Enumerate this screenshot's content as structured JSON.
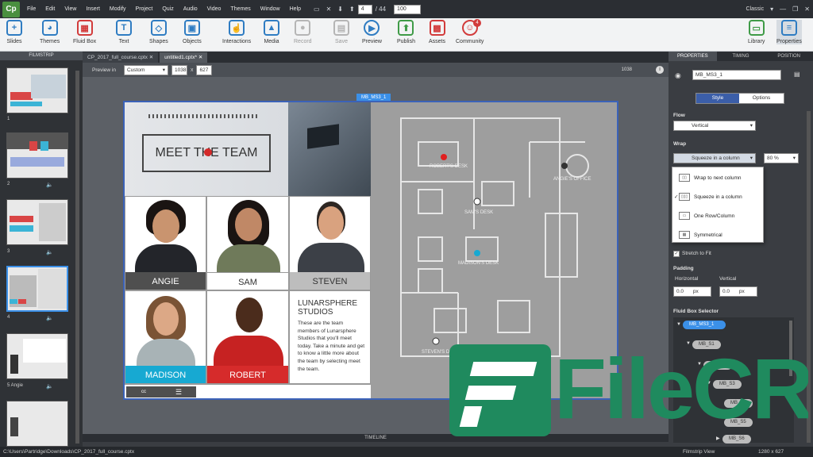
{
  "app": {
    "logo": "Cp",
    "workspace": "Classic"
  },
  "menu": [
    "File",
    "Edit",
    "View",
    "Insert",
    "Modify",
    "Project",
    "Quiz",
    "Audio",
    "Video",
    "Themes",
    "Window",
    "Help"
  ],
  "pager": {
    "current": "4",
    "total": "/ 44",
    "zoom": "100"
  },
  "toolbar": [
    "Slides",
    "Themes",
    "Fluid Box",
    "Text",
    "Shapes",
    "Objects",
    "Interactions",
    "Media",
    "Record",
    "Save",
    "Preview",
    "Publish",
    "Assets",
    "Community",
    "Library",
    "Properties"
  ],
  "community_badge": "4",
  "filmstrip": {
    "title": "FILMSTRIP",
    "slides": [
      "1",
      "2",
      "3",
      "4",
      "5 Angie",
      "6"
    ]
  },
  "tabs": [
    "CP_2017_full_course.cptx",
    "untitled1.cptx*"
  ],
  "preview": {
    "label": "Preview in",
    "mode": "Custom",
    "width": "1038",
    "x": "x",
    "height": "627",
    "ruler": "1038"
  },
  "slide": {
    "selection_label": "MB_MS3_1",
    "header": "MEET THE TEAM",
    "team": [
      {
        "name": "ANGIE",
        "color": "#4f4f4f"
      },
      {
        "name": "SAM",
        "color": "#ffffff"
      },
      {
        "name": "STEVEN",
        "color": "#bdbdbd"
      },
      {
        "name": "MADISON",
        "color": "#17a9d2"
      },
      {
        "name": "ROBERT",
        "color": "#d62b2b"
      }
    ],
    "studio_title": "LUNARSPHERE STUDIOS",
    "studio_text": "These are the team members of Lunarsphere Studios that you'll meet today. Take a minute and get to know a little more about the team by selecting meet the team.",
    "cc": "cc",
    "map_labels": [
      "ROBERT'S DESK",
      "ANGIE'S OFFICE",
      "SAM'S DESK",
      "MADISON'S DESK",
      "STEVEN'S DESK"
    ]
  },
  "timeline": "TIMELINE",
  "panel": {
    "tabs": [
      "PROPERTIES",
      "TIMING",
      "POSITION"
    ],
    "object_name": "MB_MS3_1",
    "style_tab": "Style",
    "options_tab": "Options",
    "flow_label": "Flow",
    "flow_value": "Vertical",
    "wrap_label": "Wrap",
    "wrap_value": "Squeeze in a column",
    "wrap_pct": "80 %",
    "wrap_options": [
      "Wrap to next column",
      "Squeeze in a column",
      "One Row/Column",
      "Symmetrical"
    ],
    "stretch": "Stretch to Fit",
    "padding_label": "Padding",
    "horizontal": "Horizontal",
    "vertical": "Vertical",
    "pad_h": "0.0",
    "pad_v": "0.0",
    "px": "px",
    "fbs_label": "Fluid Box Selector",
    "fbs_nodes": [
      "MB_MS3_1",
      "MB_S1",
      "MB_S2",
      "MB_S3",
      "MB_S4",
      "MB_S5",
      "MB_S6"
    ]
  },
  "status": {
    "path": "C:\\Users\\Partridge\\Downloads\\CP_2017_full_course.cptx",
    "view": "Filmstrip View",
    "size": "1280 x 627"
  },
  "watermark": "FileCR"
}
